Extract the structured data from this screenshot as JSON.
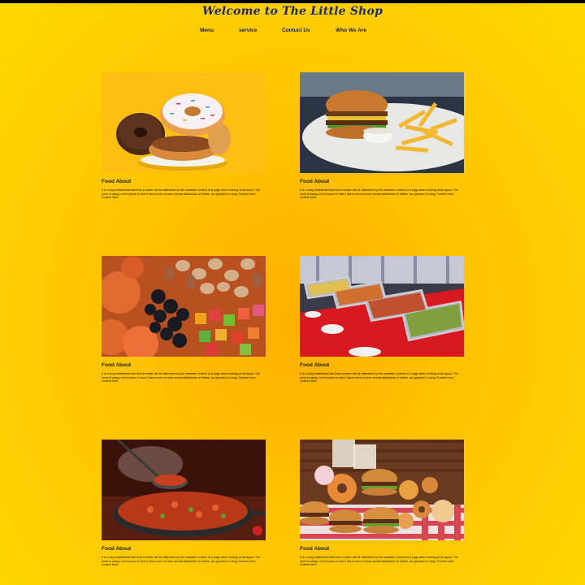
{
  "header": {
    "title": "Welcome to The Little Shop"
  },
  "nav": {
    "items": [
      {
        "label": "Menu"
      },
      {
        "label": "service"
      },
      {
        "label": "Contuct Us"
      },
      {
        "label": "Who We Are"
      }
    ]
  },
  "cards": [
    {
      "image": "donuts",
      "title": "Food About",
      "text": "It is a long established fact that a reader will be distracted by the readable content of a page when looking at its layout. The point of using Lorem Ipsum is that it has a more-or-less normal distribution of letters, as opposed to using 'Content here, content here'."
    },
    {
      "image": "burger-and-fries",
      "title": "Food About",
      "text": "It is a long established fact that a reader will be distracted by the readable content of a page when looking at its layout. The point of using Lorem Ipsum is that it has a more-or-less normal distribution of letters, as opposed to using 'Content here, content here'."
    },
    {
      "image": "dried-fruits-and-nuts",
      "title": "Food About",
      "text": "It is a long established fact that a reader will be distracted by the readable content of a page when looking at its layout. The point of using Lorem Ipsum is that it has a more-or-less normal distribution of letters, as opposed to using 'Content here, content here'."
    },
    {
      "image": "buffet-trays",
      "title": "Food About",
      "text": "It is a long established fact that a reader will be distracted by the readable content of a page when looking at its layout. The point of using Lorem Ipsum is that it has a more-or-less normal distribution of letters, as opposed to using 'Content here, content here'."
    },
    {
      "image": "soup-pan",
      "title": "Food About",
      "text": "It is a long established fact that a reader will be distracted by the readable content of a page when looking at its layout. The point of using Lorem Ipsum is that it has a more-or-less normal distribution of letters, as opposed to using 'Content here, content here'."
    },
    {
      "image": "burgers-and-donuts",
      "title": "Food About",
      "text": "It is a long established fact that a reader will be distracted by the readable content of a page when looking at its layout. The point of using Lorem Ipsum is that it has a more-or-less normal distribution of letters, as opposed to using 'Content here, content here'."
    }
  ],
  "colors": {
    "background": "#ffc400",
    "title": "#1d2a6b",
    "text": "#222222"
  }
}
